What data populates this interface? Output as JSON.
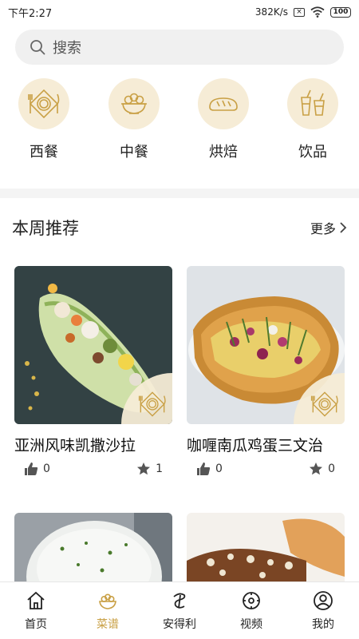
{
  "status_bar": {
    "time": "下午2:27",
    "speed": "382K/s",
    "sim": "×",
    "battery": "100"
  },
  "search": {
    "placeholder": "搜索"
  },
  "categories": [
    {
      "label": "西餐",
      "icon": "western-food-icon"
    },
    {
      "label": "中餐",
      "icon": "chinese-food-icon"
    },
    {
      "label": "烘焙",
      "icon": "bakery-icon"
    },
    {
      "label": "饮品",
      "icon": "drinks-icon"
    }
  ],
  "section": {
    "title": "本周推荐",
    "more": "更多"
  },
  "recipes": [
    {
      "title": "亚洲风味凯撒沙拉",
      "likes": "0",
      "stars": "1"
    },
    {
      "title": "咖喱南瓜鸡蛋三文治",
      "likes": "0",
      "stars": "0"
    },
    {
      "title": "",
      "likes": "",
      "stars": ""
    },
    {
      "title": "",
      "likes": "",
      "stars": ""
    }
  ],
  "tabs": [
    {
      "label": "首页",
      "icon": "home-icon"
    },
    {
      "label": "菜谱",
      "icon": "recipe-bowl-icon",
      "active": true
    },
    {
      "label": "安得利",
      "icon": "brand-logo-icon"
    },
    {
      "label": "视频",
      "icon": "video-icon"
    },
    {
      "label": "我的",
      "icon": "profile-icon"
    }
  ],
  "colors": {
    "accent": "#c9a045",
    "category_bg": "#f6ecd6",
    "divider": "#f4f4f4"
  }
}
